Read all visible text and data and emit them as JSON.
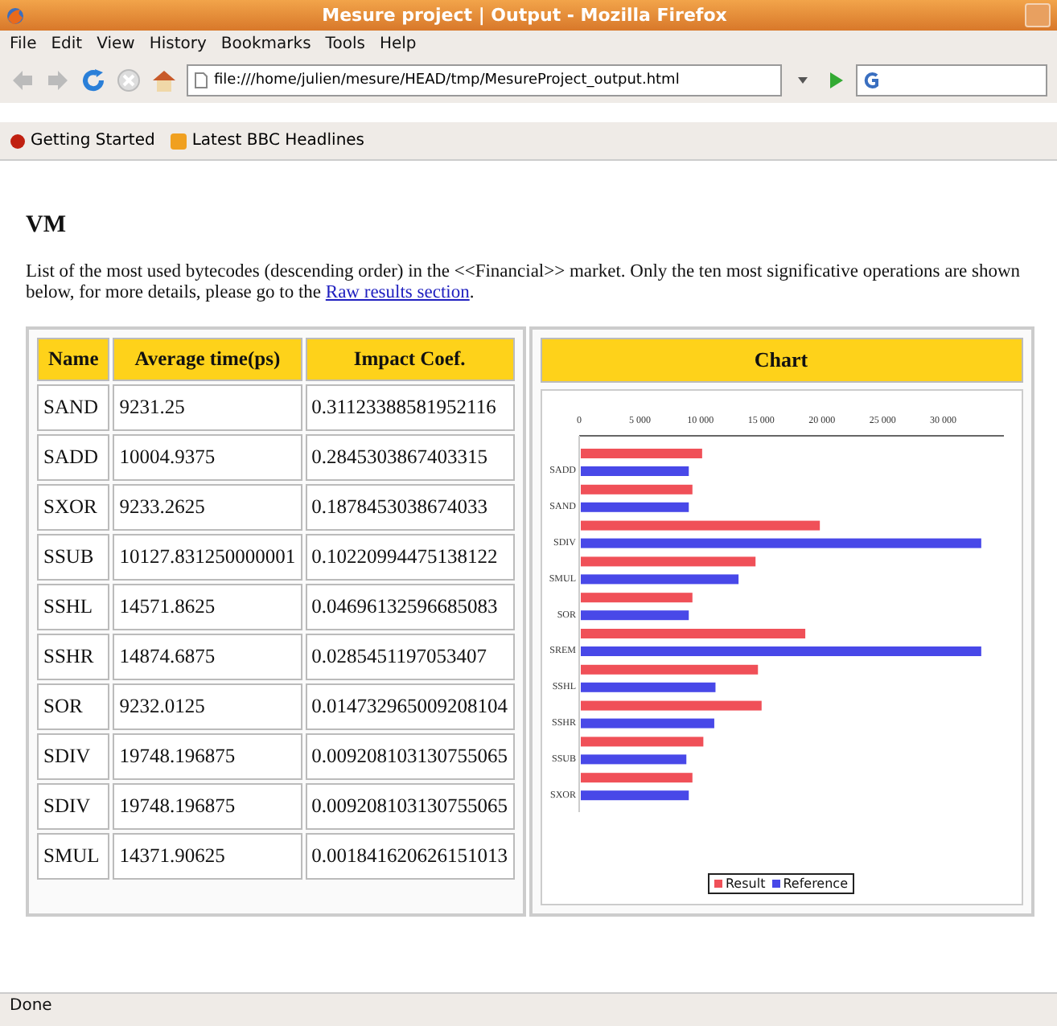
{
  "window": {
    "title": "Mesure project | Output - Mozilla Firefox"
  },
  "menu": [
    "File",
    "Edit",
    "View",
    "History",
    "Bookmarks",
    "Tools",
    "Help"
  ],
  "address_bar": {
    "value": "file:///home/julien/mesure/HEAD/tmp/MesureProject_output.html"
  },
  "bookmarks": [
    "Getting Started",
    "Latest BBC Headlines"
  ],
  "heading": "VM",
  "intro": {
    "text": "List of the most used bytecodes (descending order) in the <<Financial>> market. Only the ten most significative operations are shown below, for more details, please go to the ",
    "link": "Raw results section",
    "end": "."
  },
  "table": {
    "columns": [
      "Name",
      "Average time(ps)",
      "Impact Coef."
    ],
    "rows": [
      [
        "SAND",
        "9231.25",
        "0.31123388581952116"
      ],
      [
        "SADD",
        "10004.9375",
        "0.2845303867403315"
      ],
      [
        "SXOR",
        "9233.2625",
        "0.1878453038674033"
      ],
      [
        "SSUB",
        "10127.831250000001",
        "0.10220994475138122"
      ],
      [
        "SSHL",
        "14571.8625",
        "0.04696132596685083"
      ],
      [
        "SSHR",
        "14874.6875",
        "0.0285451197053407"
      ],
      [
        "SOR",
        "9232.0125",
        "0.014732965009208104"
      ],
      [
        "SDIV",
        "19748.196875",
        "0.009208103130755065"
      ],
      [
        "SDIV",
        "19748.196875",
        "0.009208103130755065"
      ],
      [
        "SMUL",
        "14371.90625",
        "0.001841620626151013"
      ]
    ]
  },
  "chart_panel": {
    "title": "Chart",
    "chart_data": {
      "type": "bar",
      "orientation": "horizontal",
      "categories": [
        "SADD",
        "SAND",
        "SDIV",
        "SMUL",
        "SOR",
        "SREM",
        "SSHL",
        "SSHR",
        "SSUB",
        "SXOR"
      ],
      "series": [
        {
          "name": "Result",
          "color": "#f05058",
          "values": [
            10000,
            9200,
            19700,
            14400,
            9200,
            18500,
            14600,
            14900,
            10100,
            9200
          ]
        },
        {
          "name": "Reference",
          "color": "#4848e8",
          "values": [
            8900,
            8900,
            33000,
            13000,
            8900,
            33000,
            11100,
            11000,
            8700,
            8900
          ]
        }
      ],
      "xlim": [
        0,
        35000
      ],
      "xticks": [
        {
          "value": 0,
          "label": "0"
        },
        {
          "value": 5000,
          "label": "5 000"
        },
        {
          "value": 10000,
          "label": "10 000"
        },
        {
          "value": 15000,
          "label": "15 000"
        },
        {
          "value": 20000,
          "label": "20 000"
        },
        {
          "value": 25000,
          "label": "25 000"
        },
        {
          "value": 30000,
          "label": "30 000"
        }
      ]
    }
  },
  "status_bar": "Done"
}
